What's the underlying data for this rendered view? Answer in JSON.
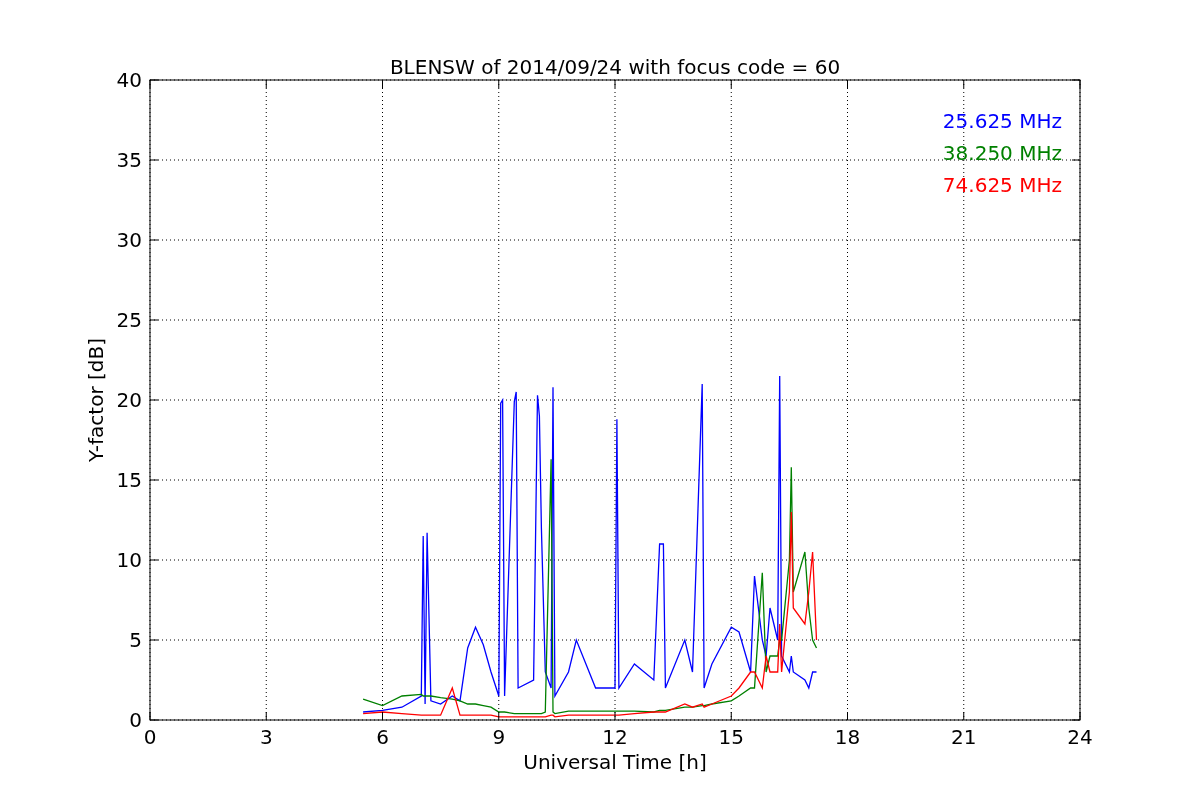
{
  "figure": {
    "chart_data": {
      "type": "line",
      "grid": true,
      "title": "BLENSW of 2014/09/24 with focus code = 60",
      "xlabel": "Universal Time [h]",
      "ylabel": "Y-factor [dB]",
      "xlim": [
        0,
        24
      ],
      "ylim": [
        0,
        40
      ],
      "xticks": [
        0,
        3,
        6,
        9,
        12,
        15,
        18,
        21,
        24
      ],
      "yticks": [
        0,
        5,
        10,
        15,
        20,
        25,
        30,
        35,
        40
      ],
      "x": [
        5.5,
        6,
        6.5,
        7,
        7.05,
        7.1,
        7.15,
        7.25,
        7.5,
        7.8,
        8,
        8.2,
        8.4,
        8.6,
        8.8,
        9,
        9.05,
        9.1,
        9.15,
        9.4,
        9.45,
        9.5,
        9.9,
        10,
        10.05,
        10.1,
        10.2,
        10.35,
        10.4,
        10.45,
        10.8,
        11,
        11.5,
        12,
        12.05,
        12.1,
        12.5,
        13,
        13.15,
        13.25,
        13.3,
        13.8,
        14,
        14.25,
        14.3,
        14.5,
        15,
        15.2,
        15.5,
        15.6,
        15.8,
        15.9,
        16,
        16.2,
        16.25,
        16.3,
        16.5,
        16.55,
        16.6,
        16.9,
        17,
        17.1,
        17.2
      ],
      "series": [
        {
          "name": "25.625 MHz",
          "color": "#0000ff",
          "values": [
            0.5,
            0.6,
            0.8,
            1.5,
            11.5,
            1,
            11.7,
            1.2,
            1,
            1.5,
            1.2,
            4.5,
            5.8,
            4.7,
            3,
            1.5,
            19.8,
            20,
            1.5,
            19.9,
            20.5,
            2,
            2.5,
            20.3,
            19,
            12,
            3,
            2,
            20.8,
            1.5,
            3,
            5,
            2,
            2,
            18.8,
            2,
            3.5,
            2.5,
            11,
            11,
            2,
            5,
            3,
            21,
            2,
            3.5,
            5.8,
            5.5,
            3,
            9,
            5,
            4,
            7,
            5,
            21.5,
            4,
            3,
            4,
            3,
            2.5,
            2,
            3,
            3
          ]
        },
        {
          "name": "38.250 MHz",
          "color": "#008000",
          "values": [
            1.3,
            0.9,
            1.5,
            1.6,
            1.5,
            1.5,
            1.5,
            1.5,
            1.4,
            1.3,
            1.2,
            1.0,
            1.0,
            0.9,
            0.8,
            0.5,
            0.5,
            0.5,
            0.5,
            0.4,
            0.4,
            0.4,
            0.4,
            0.4,
            0.4,
            0.4,
            0.5,
            16.3,
            0.5,
            0.4,
            0.55,
            0.55,
            0.55,
            0.55,
            0.55,
            0.55,
            0.55,
            0.5,
            0.6,
            0.6,
            0.6,
            0.8,
            0.8,
            0.9,
            0.9,
            1.0,
            1.2,
            1.5,
            2,
            2,
            9.2,
            3,
            4,
            4,
            5,
            5,
            10,
            15.8,
            8,
            10.5,
            7,
            5,
            4.5
          ]
        },
        {
          "name": "74.625 MHz",
          "color": "#ff0000",
          "values": [
            0.4,
            0.5,
            0.4,
            0.3,
            0.3,
            0.3,
            0.3,
            0.3,
            0.3,
            2,
            0.3,
            0.3,
            0.3,
            0.3,
            0.3,
            0.2,
            0.2,
            0.2,
            0.2,
            0.2,
            0.2,
            0.2,
            0.2,
            0.2,
            0.2,
            0.2,
            0.2,
            0.3,
            0.3,
            0.2,
            0.3,
            0.3,
            0.3,
            0.3,
            0.3,
            0.3,
            0.4,
            0.5,
            0.5,
            0.5,
            0.5,
            1,
            0.8,
            1,
            0.8,
            1,
            1.5,
            2,
            3,
            3,
            2,
            4,
            3,
            3,
            6,
            3,
            8,
            13,
            7,
            6,
            8,
            10.5,
            5
          ]
        }
      ]
    }
  }
}
